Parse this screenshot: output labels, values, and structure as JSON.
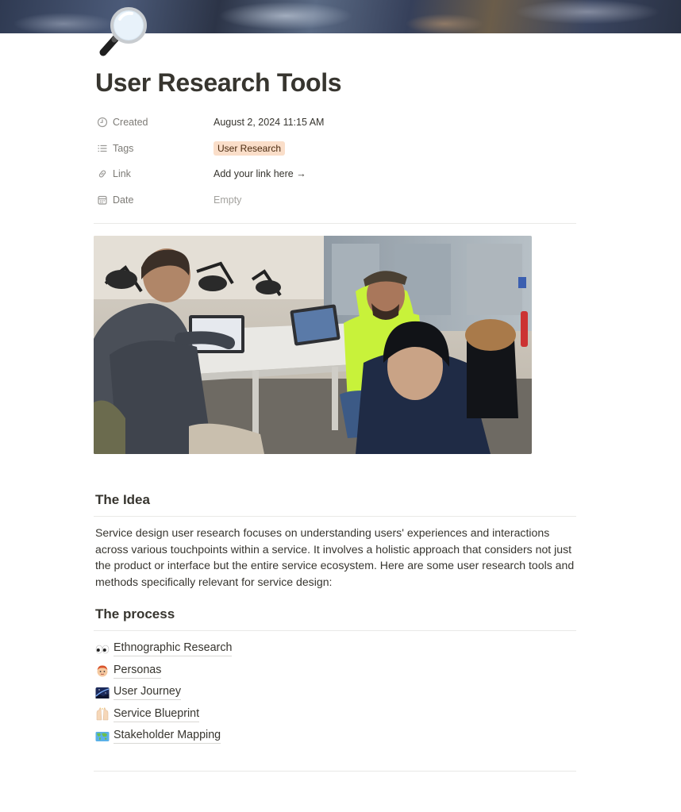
{
  "page": {
    "icon": "magnifying-glass-icon",
    "title": "User Research Tools"
  },
  "properties": [
    {
      "name": "Created",
      "icon": "clock-icon",
      "value": "August 2, 2024 11:15 AM"
    },
    {
      "name": "Tags",
      "icon": "list-icon",
      "value": "User Research"
    },
    {
      "name": "Link",
      "icon": "link-icon",
      "value": "Add your link here →"
    },
    {
      "name": "Date",
      "icon": "calendar-icon",
      "value": "Empty"
    }
  ],
  "image": {
    "subject": "photo of people working on laptops around a table"
  },
  "idea": {
    "heading": "The Idea",
    "lines": [
      "Service design user research focuses on understanding users' experiences and interactions",
      "across various touchpoints within a service. It involves a holistic approach that considers not just",
      "the product or interface but the entire service ecosystem. Here are some user research tools and",
      "methods specifically relevant for service design:"
    ]
  },
  "process": {
    "heading": "The process",
    "items": [
      {
        "label": "Ethnographic Research",
        "icon": "eyes-emoji-icon"
      },
      {
        "label": "Personas",
        "icon": "person-face-emoji-icon"
      },
      {
        "label": "User Journey",
        "icon": "night-sky-emoji-icon"
      },
      {
        "label": "Service Blueprint",
        "icon": "raised-hands-emoji-icon"
      },
      {
        "label": "Stakeholder Mapping",
        "icon": "world-map-emoji-icon"
      }
    ]
  },
  "colors": {
    "text": "#37352f",
    "muted": "#7d7b76",
    "tag_bg": "#fadec9",
    "divider": "#e9e9e7"
  }
}
